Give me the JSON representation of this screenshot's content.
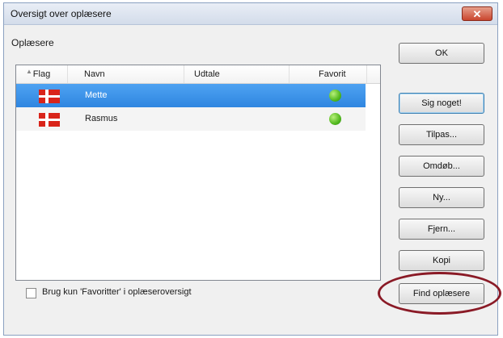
{
  "window": {
    "title": "Oversigt over oplæsere",
    "close_glyph": "✕"
  },
  "group_label": "Oplæsere",
  "columns": [
    "Flag",
    "Navn",
    "Udtale",
    "Favorit"
  ],
  "rows": [
    {
      "flag": "danish-flag-icon",
      "name": "Mette",
      "pronunciation": "",
      "favorite": true,
      "selected": true
    },
    {
      "flag": "danish-flag-icon",
      "name": "Rasmus",
      "pronunciation": "",
      "favorite": true,
      "selected": false
    }
  ],
  "buttons": {
    "ok": "OK",
    "speak": "Sig noget!",
    "adjust": "Tilpas...",
    "rename": "Omdøb...",
    "new": "Ny...",
    "remove": "Fjern...",
    "copy": "Kopi",
    "find": "Find oplæsere"
  },
  "checkbox": {
    "label": "Brug kun 'Favoritter' i oplæseroversigt",
    "checked": false
  },
  "colors": {
    "selection": "#3b8fe8",
    "favorite": "#52b81e",
    "flag_red": "#d9241a",
    "annotation": "#8a1a26"
  }
}
